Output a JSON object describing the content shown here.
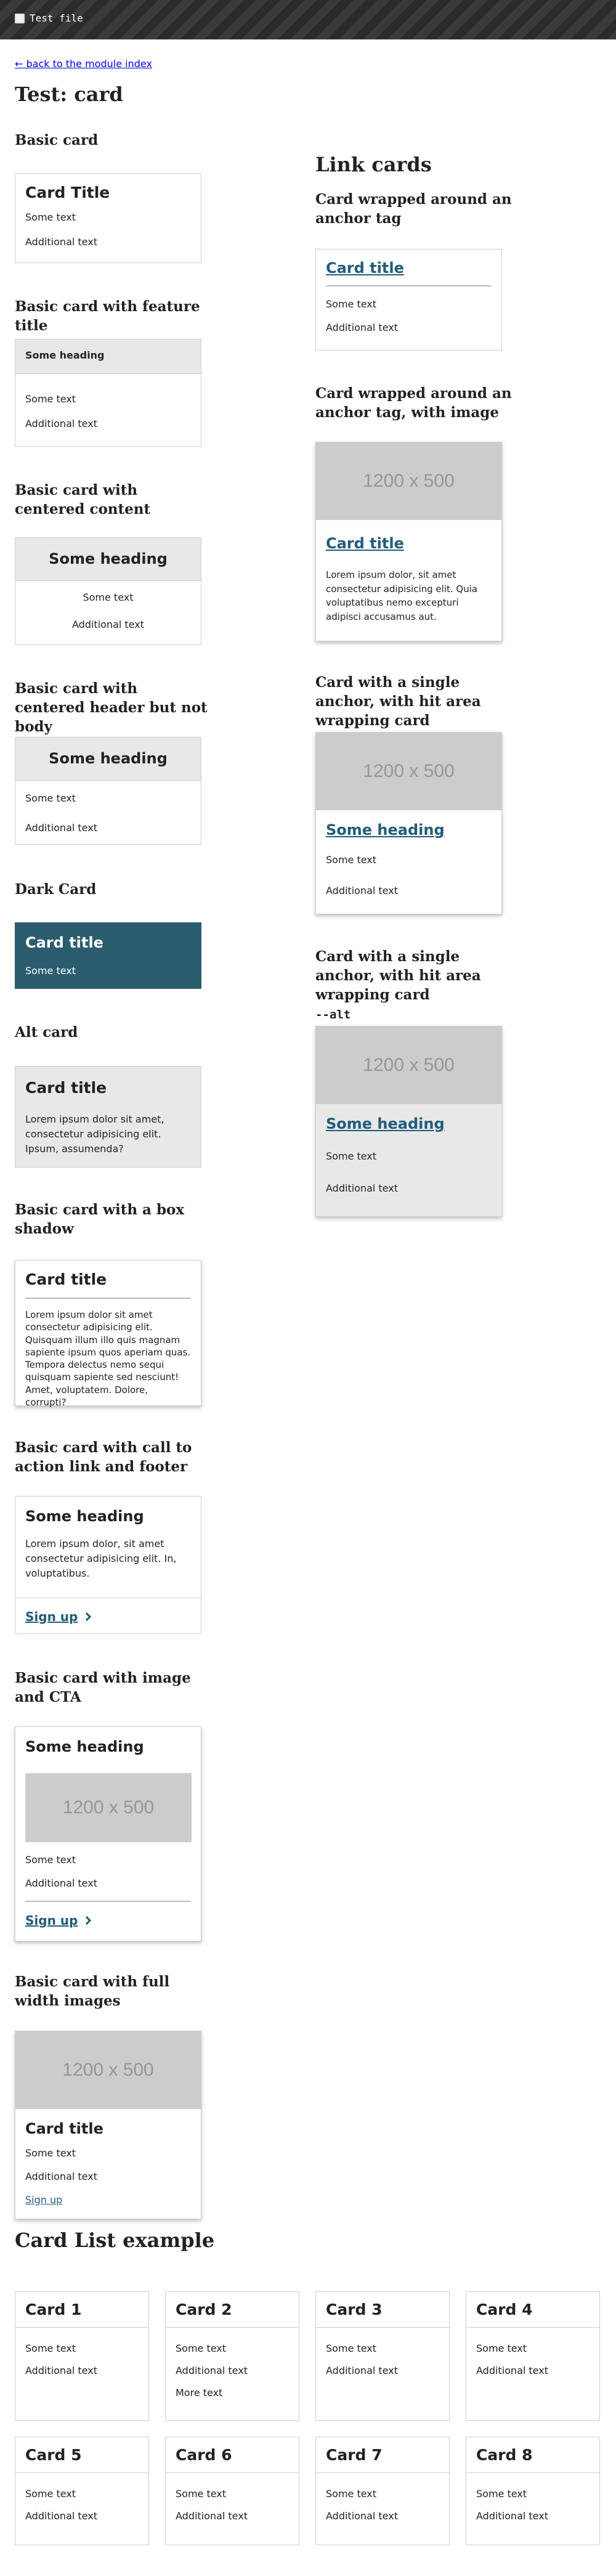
{
  "header": {
    "title": "Test file",
    "icon": "file-icon"
  },
  "nav": {
    "back_label": "← back to the module index"
  },
  "page": {
    "title": "Test: card"
  },
  "sections": {
    "basic": {
      "heading": "Basic card",
      "card": {
        "title": "Card Title",
        "text1": "Some text",
        "text2": "Additional text"
      }
    },
    "feature_title": {
      "heading": "Basic card with feature title",
      "card": {
        "header": "Some heading",
        "text1": "Some text",
        "text2": "Additional text"
      }
    },
    "centered": {
      "heading": "Basic card with centered content",
      "card": {
        "header": "Some heading",
        "text1": "Some text",
        "text2": "Additional text"
      }
    },
    "centered_header": {
      "heading": "Basic card with centered header but not body",
      "card": {
        "header": "Some heading",
        "text1": "Some text",
        "text2": "Additional text"
      }
    },
    "dark": {
      "heading": "Dark Card",
      "card": {
        "title": "Card title",
        "text1": "Some text"
      },
      "bg_color": "#2b5d6f"
    },
    "alt": {
      "heading": "Alt card",
      "card": {
        "title": "Card title",
        "para": "Lorem ipsum dolor sit amet, consectetur adipisicing elit. Ipsum, assumenda?"
      }
    },
    "box_shadow": {
      "heading": "Basic card with a box shadow",
      "card": {
        "title": "Card title",
        "para": "Lorem ipsum dolor sit amet consectetur adipisicing elit. Quisquam illum illo quis magnam sapiente ipsum quos aperiam quas. Tempora delectus nemo sequi quisquam sapiente sed nesciunt! Amet, voluptatem. Dolore, corrupti?"
      }
    },
    "cta_footer": {
      "heading": "Basic card with call to action link and footer",
      "card": {
        "title": "Some heading",
        "para": "Lorem ipsum dolor, sit amet consectetur adipisicing elit. In, voluptatibus.",
        "cta": "Sign up"
      }
    },
    "image_cta": {
      "heading": "Basic card with image and CTA",
      "card": {
        "title": "Some heading",
        "image_label": "1200 x 500",
        "text1": "Some text",
        "text2": "Additional text",
        "cta": "Sign up"
      }
    },
    "full_width": {
      "heading": "Basic card with full width images",
      "card": {
        "image_label": "1200 x 500",
        "title": "Card title",
        "text1": "Some text",
        "text2": "Additional text",
        "link": "Sign up"
      }
    }
  },
  "link_cards": {
    "heading": "Link cards",
    "anchor": {
      "heading": "Card wrapped around an anchor tag",
      "card": {
        "title": "Card title",
        "text1": "Some text",
        "text2": "Additional text"
      }
    },
    "anchor_image": {
      "heading": "Card wrapped around an anchor tag, with image",
      "card": {
        "image_label": "1200 x 500",
        "title": "Card title",
        "para": "Lorem ipsum dolor, sit amet consectetur adipisicing elit. Quia voluptatibus nemo excepturi adipisci accusamus aut."
      }
    },
    "single_anchor": {
      "heading": "Card with a single anchor, with hit area wrapping card",
      "card": {
        "image_label": "1200 x 500",
        "title": "Some heading",
        "text1": "Some text",
        "text2": "Additional text"
      }
    },
    "single_anchor_alt": {
      "heading": "Card with a single anchor, with hit area wrapping card",
      "heading_code": "--alt",
      "card": {
        "image_label": "1200 x 500",
        "title": "Some heading",
        "text1": "Some text",
        "text2": "Additional text"
      }
    }
  },
  "card_list": {
    "heading": "Card List example",
    "cards": [
      {
        "title": "Card 1",
        "lines": [
          "Some text",
          "Additional text"
        ]
      },
      {
        "title": "Card 2",
        "lines": [
          "Some text",
          "Additional text",
          "More text"
        ]
      },
      {
        "title": "Card 3",
        "lines": [
          "Some text",
          "Additional text"
        ]
      },
      {
        "title": "Card 4",
        "lines": [
          "Some text",
          "Additional text"
        ]
      },
      {
        "title": "Card 5",
        "lines": [
          "Some text",
          "Additional text"
        ]
      },
      {
        "title": "Card 6",
        "lines": [
          "Some text",
          "Additional text"
        ]
      },
      {
        "title": "Card 7",
        "lines": [
          "Some text",
          "Additional text"
        ]
      },
      {
        "title": "Card 8",
        "lines": [
          "Some text",
          "Additional text"
        ]
      }
    ]
  },
  "colors": {
    "link": "#215d7a",
    "dark_card": "#2b5d6f",
    "alt_bg": "#e8e8e8",
    "placeholder": "#cccccc"
  }
}
